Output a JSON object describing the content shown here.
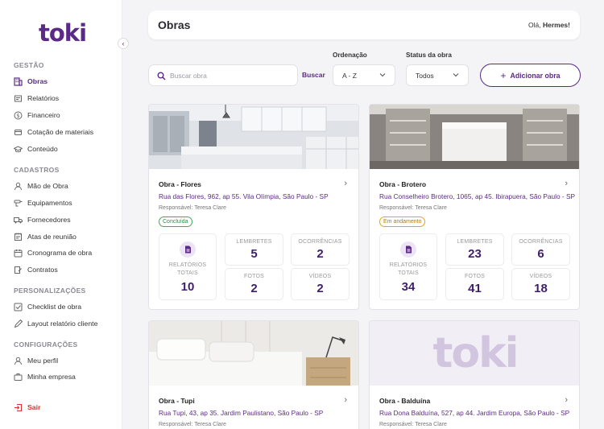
{
  "brand": {
    "logo_text": "toki",
    "primary_color": "#5b2a86",
    "danger_color": "#d9342b"
  },
  "sidebar": {
    "sections": [
      {
        "title": "GESTÃO",
        "items": [
          {
            "label": "Obras",
            "icon": "building-icon",
            "active": true
          },
          {
            "label": "Relatórios",
            "icon": "document-icon"
          },
          {
            "label": "Financeiro",
            "icon": "dollar-icon"
          },
          {
            "label": "Cotação de materiais",
            "icon": "cart-icon"
          },
          {
            "label": "Conteúdo",
            "icon": "graduation-cap-icon"
          }
        ]
      },
      {
        "title": "CADASTROS",
        "items": [
          {
            "label": "Mão de Obra",
            "icon": "person-icon"
          },
          {
            "label": "Equipamentos",
            "icon": "drill-icon"
          },
          {
            "label": "Fornecedores",
            "icon": "truck-icon"
          },
          {
            "label": "Atas de reunião",
            "icon": "notes-icon"
          },
          {
            "label": "Cronograma de obra",
            "icon": "calendar-icon"
          },
          {
            "label": "Contratos",
            "icon": "contract-icon"
          }
        ]
      },
      {
        "title": "PERSONALIZAÇÕES",
        "items": [
          {
            "label": "Checklist de obra",
            "icon": "checklist-icon"
          },
          {
            "label": "Layout relatório cliente",
            "icon": "pencil-icon"
          }
        ]
      },
      {
        "title": "CONFIGURAÇÕES",
        "items": [
          {
            "label": "Meu perfil",
            "icon": "person-icon"
          },
          {
            "label": "Minha empresa",
            "icon": "briefcase-icon"
          }
        ]
      }
    ],
    "logout_label": "Sair",
    "collapse_icon": "chevron-left-icon"
  },
  "header": {
    "title": "Obras",
    "greeting_prefix": "Olá, ",
    "user_name": "Hermes!"
  },
  "filters": {
    "search_placeholder": "Buscar obra",
    "search_value": "",
    "search_button": "Buscar",
    "order_label": "Ordenação",
    "order_value": "A - Z",
    "status_label": "Status da obra",
    "status_value": "Todos",
    "add_button": "Adicionar obra"
  },
  "projects": [
    {
      "title": "Obra - Flores",
      "address": "Rua das Flores, 962, ap 55. Vila Olímpia, São Paulo - SP",
      "responsible": "Responsável: Teresa Clare",
      "status": "Concluída",
      "status_kind": "ok",
      "stats": {
        "reports_label": "RELATÓRIOS TOTAIS",
        "reports": "10",
        "reminders_label": "LEMBRETES",
        "reminders": "5",
        "occurrences_label": "OCORRÊNCIAS",
        "occurrences": "2",
        "photos_label": "FOTOS",
        "photos": "2",
        "videos_label": "VÍDEOS",
        "videos": "2"
      }
    },
    {
      "title": "Obra - Brotero",
      "address": "Rua Conselheiro Brotero, 1065, ap 45. Ibirapuera, São Paulo - SP",
      "responsible": "Responsável: Teresa Clare",
      "status": "Em andamento",
      "status_kind": "prog",
      "stats": {
        "reports_label": "RELATÓRIOS TOTAIS",
        "reports": "34",
        "reminders_label": "LEMBRETES",
        "reminders": "23",
        "occurrences_label": "OCORRÊNCIAS",
        "occurrences": "6",
        "photos_label": "FOTOS",
        "photos": "41",
        "videos_label": "VÍDEOS",
        "videos": "18"
      }
    },
    {
      "title": "Obra - Tupi",
      "address": "Rua Tupi, 43, ap 35. Jardim Paulistano, São Paulo - SP",
      "responsible": "Responsável: Teresa Clare"
    },
    {
      "title": "Obra - Balduína",
      "address": "Rua Dona Balduína, 527, ap 44. Jardim Europa, São Paulo - SP",
      "responsible": "Responsável: Teresa Clare",
      "placeholder_logo": "toki"
    }
  ]
}
